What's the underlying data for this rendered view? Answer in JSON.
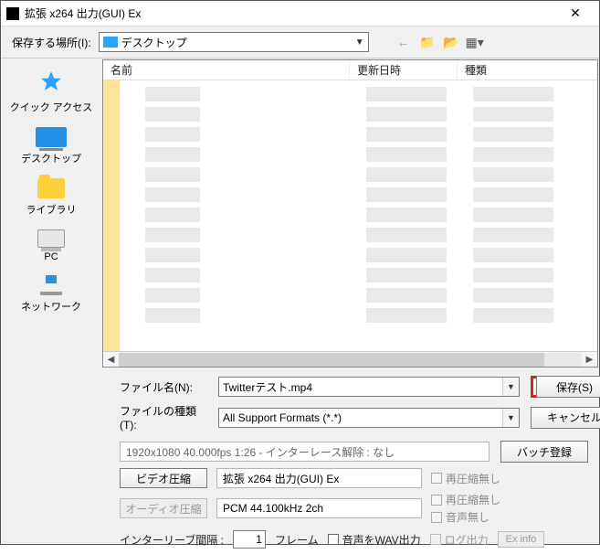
{
  "window": {
    "title": "拡張 x264 出力(GUI) Ex",
    "close": "✕"
  },
  "toolbar": {
    "save_in_label": "保存する場所(I):",
    "location": "デスクトップ",
    "nav": {
      "back": "←",
      "up": "📂",
      "new": "📁*",
      "view": "▦▾"
    }
  },
  "sidebar": {
    "items": [
      {
        "label": "クイック アクセス",
        "icon": "star"
      },
      {
        "label": "デスクトップ",
        "icon": "monitor"
      },
      {
        "label": "ライブラリ",
        "icon": "folder"
      },
      {
        "label": "PC",
        "icon": "pc"
      },
      {
        "label": "ネットワーク",
        "icon": "network"
      }
    ]
  },
  "columns": {
    "name": "名前",
    "date": "更新日時",
    "type": "種類"
  },
  "form": {
    "filename_label": "ファイル名(N):",
    "filename_value": "Twitterテスト.mp4",
    "filetype_label": "ファイルの種類(T):",
    "filetype_value": "All Support Formats (*.*)",
    "save_btn": "保存(S)",
    "cancel_btn": "キャンセル"
  },
  "footer": {
    "info": "1920x1080  40.000fps  1:26  -  インターレース解除 : なし",
    "batch_btn": "バッチ登録",
    "video_btn": "ビデオ圧縮",
    "video_codec": "拡張 x264 出力(GUI) Ex",
    "audio_btn": "オーディオ圧縮",
    "audio_codec": "PCM 44.100kHz 2ch",
    "chk_recompress_v": "再圧縮無し",
    "chk_recompress_a": "再圧縮無し",
    "chk_audio_none": "音声無し"
  },
  "lastrow": {
    "interleave_label": "インターリーブ間隔 :",
    "interleave_value": "1",
    "frame_unit": "フレーム",
    "wav_out": "音声をWAV出力",
    "log_out": "ログ出力",
    "exinfo": "Ex info"
  }
}
